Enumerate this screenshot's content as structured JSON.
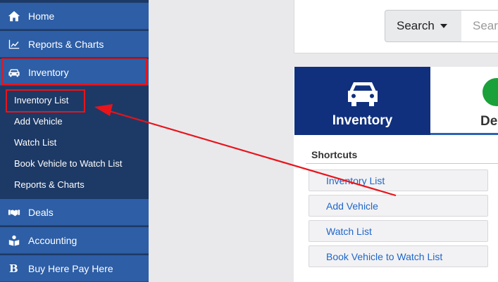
{
  "sidebar": {
    "items": [
      {
        "label": "Home",
        "icon": "home-icon"
      },
      {
        "label": "Reports & Charts",
        "icon": "line-chart-icon"
      },
      {
        "label": "Inventory",
        "icon": "car-icon"
      },
      {
        "label": "Deals",
        "icon": "handshake-icon"
      },
      {
        "label": "Accounting",
        "icon": "accounting-icon"
      },
      {
        "label": "Buy Here Pay Here",
        "icon": "b-letter-icon"
      }
    ],
    "inventory_sub": [
      "Inventory List",
      "Add Vehicle",
      "Watch List",
      "Book Vehicle to Watch List",
      "Reports & Charts"
    ],
    "bhph_glyph": "B"
  },
  "search": {
    "dropdown_label": "Search",
    "placeholder": "Search"
  },
  "tiles": [
    {
      "label": "Inventory"
    },
    {
      "label": "De"
    }
  ],
  "shortcuts": {
    "heading": "Shortcuts",
    "items": [
      "Inventory List",
      "Add Vehicle",
      "Watch List",
      "Book Vehicle to Watch List"
    ]
  },
  "colors": {
    "sidebar_bg": "#1d3a66",
    "nav_item_bg": "#2d5ea6",
    "tile_bg": "#10307e",
    "link": "#2066c8",
    "annotation_red": "#e8141a",
    "deals_green": "#1aa13a"
  }
}
